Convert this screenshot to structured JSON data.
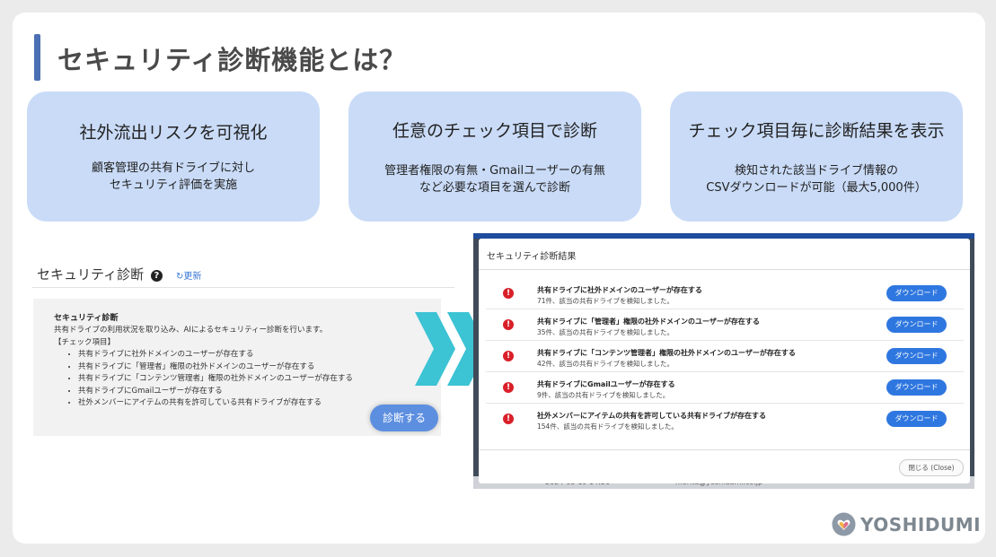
{
  "title": "セキュリティ診断機能とは？",
  "cards": [
    {
      "title": "社外流出リスクを可視化",
      "desc": [
        "顧客管理の共有ドライブに対し",
        "セキュリティ評価を実施"
      ]
    },
    {
      "title": "任意のチェック項目で診断",
      "desc": [
        "管理者権限の有無・Gmailユーザーの有無",
        "など必要な項目を選んで診断"
      ]
    },
    {
      "title": "チェック項目毎に診断結果を表示",
      "desc": [
        "検知された該当ドライブ情報の",
        "CSVダウンロードが可能（最大5,000件）"
      ]
    }
  ],
  "left_panel": {
    "header": "セキュリティ診断",
    "refresh_label": "更新",
    "box_title": "セキュリティ診断",
    "box_desc": "共有ドライブの利用状況を取り込み、AIによるセキュリティー診断を行います。",
    "check_label": "【チェック項目】",
    "items": [
      "共有ドライブに社外ドメインのユーザーが存在する",
      "共有ドライブに「管理者」権限の社外ドメインのユーザーが存在する",
      "共有ドライブに「コンテンツ管理者」権限の社外ドメインのユーザーが存在する",
      "共有ドライブにGmailユーザーが存在する",
      "社外メンバーにアイテムの共有を許可している共有ドライブが存在する"
    ],
    "scan_button": "診断する"
  },
  "dialog": {
    "title": "セキュリティ診断結果",
    "rows": [
      {
        "title": "共有ドライブに社外ドメインのユーザーが存在する",
        "sub": "71件、該当の共有ドライブを検知しました。"
      },
      {
        "title": "共有ドライブに「管理者」権限の社外ドメインのユーザーが存在する",
        "sub": "35件、該当の共有ドライブを検知しました。"
      },
      {
        "title": "共有ドライブに「コンテンツ管理者」権限の社外ドメインのユーザーが存在する",
        "sub": "42件、該当の共有ドライブを検知しました。"
      },
      {
        "title": "共有ドライブにGmailユーザーが存在する",
        "sub": "9件、該当の共有ドライブを検知しました。"
      },
      {
        "title": "社外メンバーにアイテムの共有を許可している共有ドライブが存在する",
        "sub": "154件、該当の共有ドライブを検知しました。"
      }
    ],
    "download_label": "ダウンロード",
    "close_label": "閉じる (Close)",
    "behind_date": "2024-03-19 14:26",
    "behind_email": "morita@yoshidumi.co.jp"
  },
  "logo_text": "YOSHIDUMI",
  "colors": {
    "accent": "#4a6fb3",
    "card": "#c9dbf7",
    "chevron": "#3cc3d4",
    "button": "#2f77e0",
    "warn": "#d9202a"
  }
}
